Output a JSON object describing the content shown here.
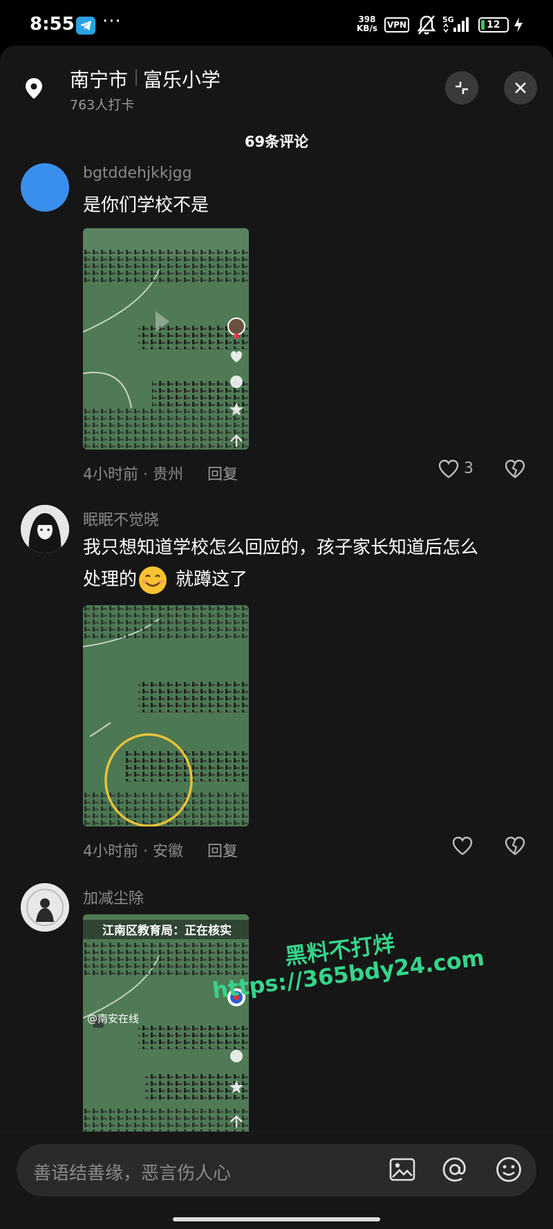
{
  "statusbar": {
    "time": "8:55",
    "net_speed_value": "398",
    "net_speed_unit": "KB/s",
    "vpn": "VPN",
    "network": "5G",
    "battery": "12"
  },
  "header": {
    "city": "南宁市",
    "place": "富乐小学",
    "checkins": "763人打卡"
  },
  "comments_title": "69条评论",
  "comments": [
    {
      "user": "bgtddehjkkjgg",
      "text": "是你们学校不是",
      "time": "4小时前",
      "location": "贵州",
      "reply": "回复",
      "likes": "3"
    },
    {
      "user": "眠眠不觉晓",
      "text_line1": "我只想知道学校怎么回应的，孩子家长知道后怎么",
      "text_line2a": "处理的",
      "text_line2b": "就蹲这了",
      "time": "4小时前",
      "location": "安徽",
      "reply": "回复"
    },
    {
      "user": "加减尘除",
      "image_caption": "江南区教育局：正在核实",
      "image_source": "@南安在线"
    }
  ],
  "input": {
    "placeholder": "善语结善缘，恶言伤人心"
  },
  "watermark": {
    "line1": "黑料不打烊",
    "line2": "https://365bdy24.com"
  }
}
